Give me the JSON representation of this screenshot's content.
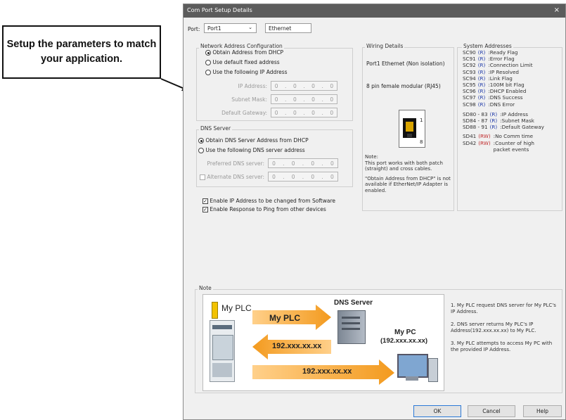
{
  "callout": {
    "text": "Setup the parameters to match your application."
  },
  "dialog": {
    "title": "Com Port Setup Details",
    "close": "×"
  },
  "port": {
    "label": "Port:",
    "value": "Port1",
    "type": "Ethernet"
  },
  "network": {
    "title": "Network Address Configuration",
    "options": [
      "Obtain Address from DHCP",
      "Use default fixed address",
      "Use the following IP Address"
    ],
    "selected": 0,
    "fields": [
      {
        "label": "IP Address:",
        "value": [
          "0",
          "0",
          "0",
          "0"
        ]
      },
      {
        "label": "Subnet Mask:",
        "value": [
          "0",
          "0",
          "0",
          "0"
        ]
      },
      {
        "label": "Default Gateway:",
        "value": [
          "0",
          "0",
          "0",
          "0"
        ]
      }
    ]
  },
  "dns": {
    "title": "DNS Server",
    "options": [
      "Obtain DNS Server Address from DHCP",
      "Use the following DNS server address"
    ],
    "selected": 0,
    "preferred_label": "Preferred DNS server:",
    "preferred_value": [
      "0",
      "0",
      "0",
      "0"
    ],
    "alternate_label": "Alternate DNS server:",
    "alternate_value": [
      "0",
      "0",
      "0",
      "0"
    ]
  },
  "checks": [
    {
      "label": "Enable IP Address to be changed from Software",
      "checked": true
    },
    {
      "label": "Enable Response to Ping from other devices",
      "checked": true
    }
  ],
  "wiring": {
    "title": "Wiring Details",
    "line1": "Port1 Ethernet (Non isolation)",
    "line2": "8 pin female modular (RJ45)",
    "pin1": "1",
    "pin8": "8",
    "note_title": "Note:",
    "note1": "This port works with both patch (straight) and cross cables.",
    "note2": "\"Obtain Address from DHCP\" is not available if EtherNet/IP Adapter is enabled."
  },
  "system": {
    "title": "System Addresses",
    "rows": [
      {
        "addr": "SC90",
        "mode": "(R)",
        "desc": ":Ready Flag"
      },
      {
        "addr": "SC91",
        "mode": "(R)",
        "desc": ":Error Flag"
      },
      {
        "addr": "SC92",
        "mode": "(R)",
        "desc": ":Connection Limit"
      },
      {
        "addr": "SC93",
        "mode": "(R)",
        "desc": ":IP Resolved"
      },
      {
        "addr": "SC94",
        "mode": "(R)",
        "desc": ":Link Flag"
      },
      {
        "addr": "SC95",
        "mode": "(R)",
        "desc": ":100M bit Flag"
      },
      {
        "addr": "SC96",
        "mode": "(R)",
        "desc": ":DHCP Enabled"
      },
      {
        "addr": "SC97",
        "mode": "(R)",
        "desc": ":DNS Success"
      },
      {
        "addr": "SC98",
        "mode": "(R)",
        "desc": ":DNS Error"
      }
    ],
    "rows2": [
      {
        "addr": "SD80 - 83",
        "mode": "(R)",
        "desc": ":IP Address"
      },
      {
        "addr": "SD84 - 87",
        "mode": "(R)",
        "desc": ":Subnet Mask"
      },
      {
        "addr": "SD88 - 91",
        "mode": "(R)",
        "desc": ":Default Gateway"
      }
    ],
    "rows3": [
      {
        "addr": "SD41",
        "mode": "(RW)",
        "desc": ":No Comm time"
      },
      {
        "addr": "SD42",
        "mode": "(RW)",
        "desc": ":Counter of high packet events"
      }
    ]
  },
  "note": {
    "title": "Note",
    "diagram": {
      "plc_label": "My PLC",
      "dns_label": "DNS Server",
      "pc_label": "My PC",
      "pc_ip": "(192.xxx.xx.xx)",
      "arrow1": "My PLC",
      "arrow2": "192.xxx.xx.xx",
      "arrow3": "192.xxx.xx.xx"
    },
    "steps": [
      "1. My PLC request DNS server for My PLC's IP Address.",
      "2. DNS server returns My PLC's IP Address(192.xxx.xx.xx) to My PLC.",
      "3. My PLC attempts to access My PC with the provided IP Address."
    ]
  },
  "buttons": {
    "ok": "OK",
    "cancel": "Cancel",
    "help": "Help"
  }
}
